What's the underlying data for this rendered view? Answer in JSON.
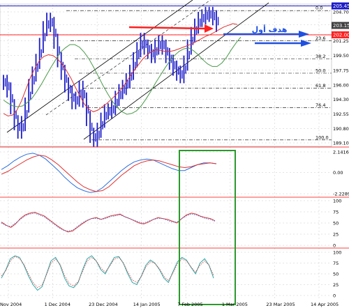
{
  "colors": {
    "background": "#ffffff",
    "grid": "#c8c8c8",
    "price_bars": "#1c1cc8",
    "ma_red": "#e03030",
    "ma_green": "#4a9a4a",
    "channel": "#000000",
    "fib_lines": "#000000",
    "current_price_line": "#1c1cc8",
    "target_line": "#ff2020",
    "annotation_arrow_red": "#ff2020",
    "annotation_arrow_blue": "#2050e0",
    "highlight_box": "#2a9a2a",
    "panel_separator": "#ff4040",
    "oscillator_blue": "#2a6ee0",
    "oscillator_red": "#e03030",
    "stoch_teal": "#2aa8a8"
  },
  "annotation": {
    "arabic_text": "هدف أول"
  },
  "chart_data": [
    {
      "type": "line",
      "panel": "price",
      "title": "",
      "x_ticks": [
        "Nov 2004",
        "1 Dec 2004",
        "23 Dec 2004",
        "14 Jan 2005",
        "7 Feb 2005",
        "1 Mar 2005",
        "23 Mar 2005",
        "14 Apr 2005"
      ],
      "y_ticks": [
        205.45,
        204.7,
        203.15,
        202.0,
        201.25,
        199.5,
        197.75,
        196.0,
        194.3,
        192.55,
        190.8,
        189.1
      ],
      "ylim": [
        189.1,
        205.45
      ],
      "price_label_current": "205.45",
      "price_label_secondary": "203.15",
      "price_label_target": "202.00",
      "fibonacci_levels": [
        {
          "label": "0.0",
          "price": 204.85
        },
        {
          "label": "23.6",
          "price": 201.25
        },
        {
          "label": "38.2",
          "price": 199.1
        },
        {
          "label": "50.0",
          "price": 197.4
        },
        {
          "label": "61.8",
          "price": 195.6
        },
        {
          "label": "76.4",
          "price": 193.3
        },
        {
          "label": "100.0",
          "price": 189.45
        }
      ],
      "series": [
        {
          "values": [
            196.3,
            195.4,
            193.4,
            191.5,
            190.5,
            191.4,
            193.6,
            195.8,
            197.3,
            198.8,
            200.7,
            202.7,
            203.7,
            203.2,
            201.2,
            199.0,
            197.5,
            196.0,
            195.0,
            194.0,
            194.3,
            195.6,
            194.2,
            192.0,
            190.0,
            189.5,
            190.6,
            191.8,
            192.8,
            192.9,
            193.3,
            194.4,
            195.2,
            195.7,
            196.5,
            197.5,
            199.0,
            200.2,
            201.3,
            200.5,
            200.0,
            199.5,
            200.5,
            201.0,
            200.5,
            199.5,
            198.7,
            198.0,
            197.4,
            197.1,
            198.6,
            200.5,
            202.0,
            203.0,
            203.8,
            204.1,
            204.4,
            204.4,
            204.0,
            203.2
          ]
        },
        {
          "values": [
            192.6,
            192.3,
            192.4,
            193.0,
            194.1,
            195.5,
            196.9,
            198.0,
            198.9,
            199.4,
            199.6,
            199.5,
            199.1,
            198.5,
            197.7,
            196.8,
            195.7,
            194.7,
            193.7,
            193.1,
            192.8,
            193.0,
            193.4,
            193.8,
            194.3,
            194.8,
            195.4,
            196.1,
            196.9,
            197.7,
            198.4,
            199.1,
            199.6,
            200.0,
            200.2,
            200.1,
            200.0,
            200.0,
            200.1,
            200.3,
            200.5,
            200.7,
            200.9,
            201.2,
            201.5,
            201.8,
            202.0,
            202.3,
            202.6,
            202.9,
            203.1,
            203.3,
            203.2
          ]
        },
        {
          "values": [
            194.2,
            193.8,
            193.5,
            193.4,
            193.5,
            193.9,
            194.4,
            195.2,
            196.1,
            197.1,
            198.1,
            199.0,
            199.9,
            200.4,
            200.8,
            200.8,
            200.5,
            199.9,
            199.1,
            198.1,
            197.0,
            195.9,
            194.9,
            194.0,
            193.3,
            192.8,
            192.5,
            192.6,
            192.9,
            193.5,
            194.3,
            195.2,
            196.2,
            197.1,
            198.0,
            198.8,
            199.5,
            200.0,
            200.3,
            200.4,
            200.1,
            199.6,
            199.0,
            198.5,
            198.2,
            198.2,
            198.6,
            199.3,
            200.2,
            201.0,
            201.7
          ]
        }
      ]
    },
    {
      "type": "line",
      "panel": "oscillator",
      "y_ticks": [
        2.1416,
        0.0,
        -2.2289
      ],
      "ylim": [
        -2.2289,
        2.1416
      ],
      "series": [
        {
          "values": [
            0.3,
            0.7,
            1.2,
            1.6,
            1.9,
            2.0,
            1.8,
            1.4,
            0.8,
            0.2,
            -0.5,
            -1.1,
            -1.6,
            -1.9,
            -2.1,
            -2.0,
            -1.6,
            -1.0,
            -0.4,
            0.2,
            0.7,
            1.1,
            1.3,
            1.4,
            1.3,
            1.0,
            0.7,
            0.4,
            0.2,
            0.2,
            0.5,
            0.8,
            1.0,
            1.0,
            0.9
          ]
        },
        {
          "values": [
            -0.2,
            0.1,
            0.5,
            0.9,
            1.3,
            1.6,
            1.8,
            1.7,
            1.3,
            0.8,
            0.2,
            -0.4,
            -1.0,
            -1.5,
            -1.8,
            -2.0,
            -1.9,
            -1.5,
            -0.9,
            -0.3,
            0.2,
            0.7,
            1.0,
            1.2,
            1.3,
            1.2,
            1.0,
            0.8,
            0.6,
            0.5,
            0.6,
            0.8,
            0.9,
            1.0,
            0.9
          ]
        }
      ]
    },
    {
      "type": "line",
      "panel": "rsi",
      "y_ticks": [
        100,
        75,
        50,
        25,
        0
      ],
      "ylim": [
        0,
        100
      ],
      "series": [
        {
          "values": [
            52,
            45,
            40,
            48,
            60,
            68,
            72,
            74,
            70,
            66,
            58,
            50,
            42,
            35,
            30,
            32,
            40,
            48,
            55,
            60,
            62,
            58,
            62,
            66,
            68,
            70,
            64,
            60,
            55,
            50,
            48,
            52,
            58,
            62,
            60,
            58,
            54,
            50,
            60,
            68,
            72,
            70,
            65,
            62,
            60,
            55
          ]
        },
        {
          "values": [
            50,
            44,
            42,
            50,
            58,
            66,
            70,
            72,
            68,
            64,
            56,
            48,
            40,
            34,
            32,
            34,
            42,
            50,
            56,
            60,
            60,
            58,
            60,
            64,
            66,
            68,
            64,
            60,
            56,
            52,
            50,
            54,
            58,
            60,
            60,
            56,
            52,
            52,
            60,
            66,
            70,
            68,
            64,
            60,
            58,
            54
          ]
        }
      ]
    },
    {
      "type": "line",
      "panel": "stochastic",
      "y_ticks": [
        100,
        75,
        50,
        25,
        0
      ],
      "ylim": [
        0,
        100
      ],
      "series": [
        {
          "values": [
            40,
            60,
            85,
            92,
            88,
            70,
            45,
            25,
            12,
            20,
            50,
            80,
            88,
            70,
            40,
            22,
            18,
            30,
            60,
            85,
            92,
            80,
            60,
            50,
            70,
            88,
            90,
            75,
            50,
            30,
            25,
            45,
            70,
            82,
            75,
            60,
            40,
            30,
            55,
            78,
            88,
            82,
            65,
            50,
            75,
            85,
            70,
            40
          ]
        },
        {
          "values": [
            45,
            58,
            80,
            90,
            86,
            72,
            50,
            30,
            18,
            24,
            48,
            75,
            84,
            72,
            46,
            28,
            22,
            32,
            56,
            80,
            88,
            80,
            64,
            54,
            68,
            84,
            88,
            76,
            54,
            36,
            30,
            44,
            66,
            78,
            74,
            62,
            44,
            34,
            52,
            74,
            84,
            80,
            66,
            54,
            70,
            80,
            70,
            46
          ]
        }
      ]
    }
  ]
}
